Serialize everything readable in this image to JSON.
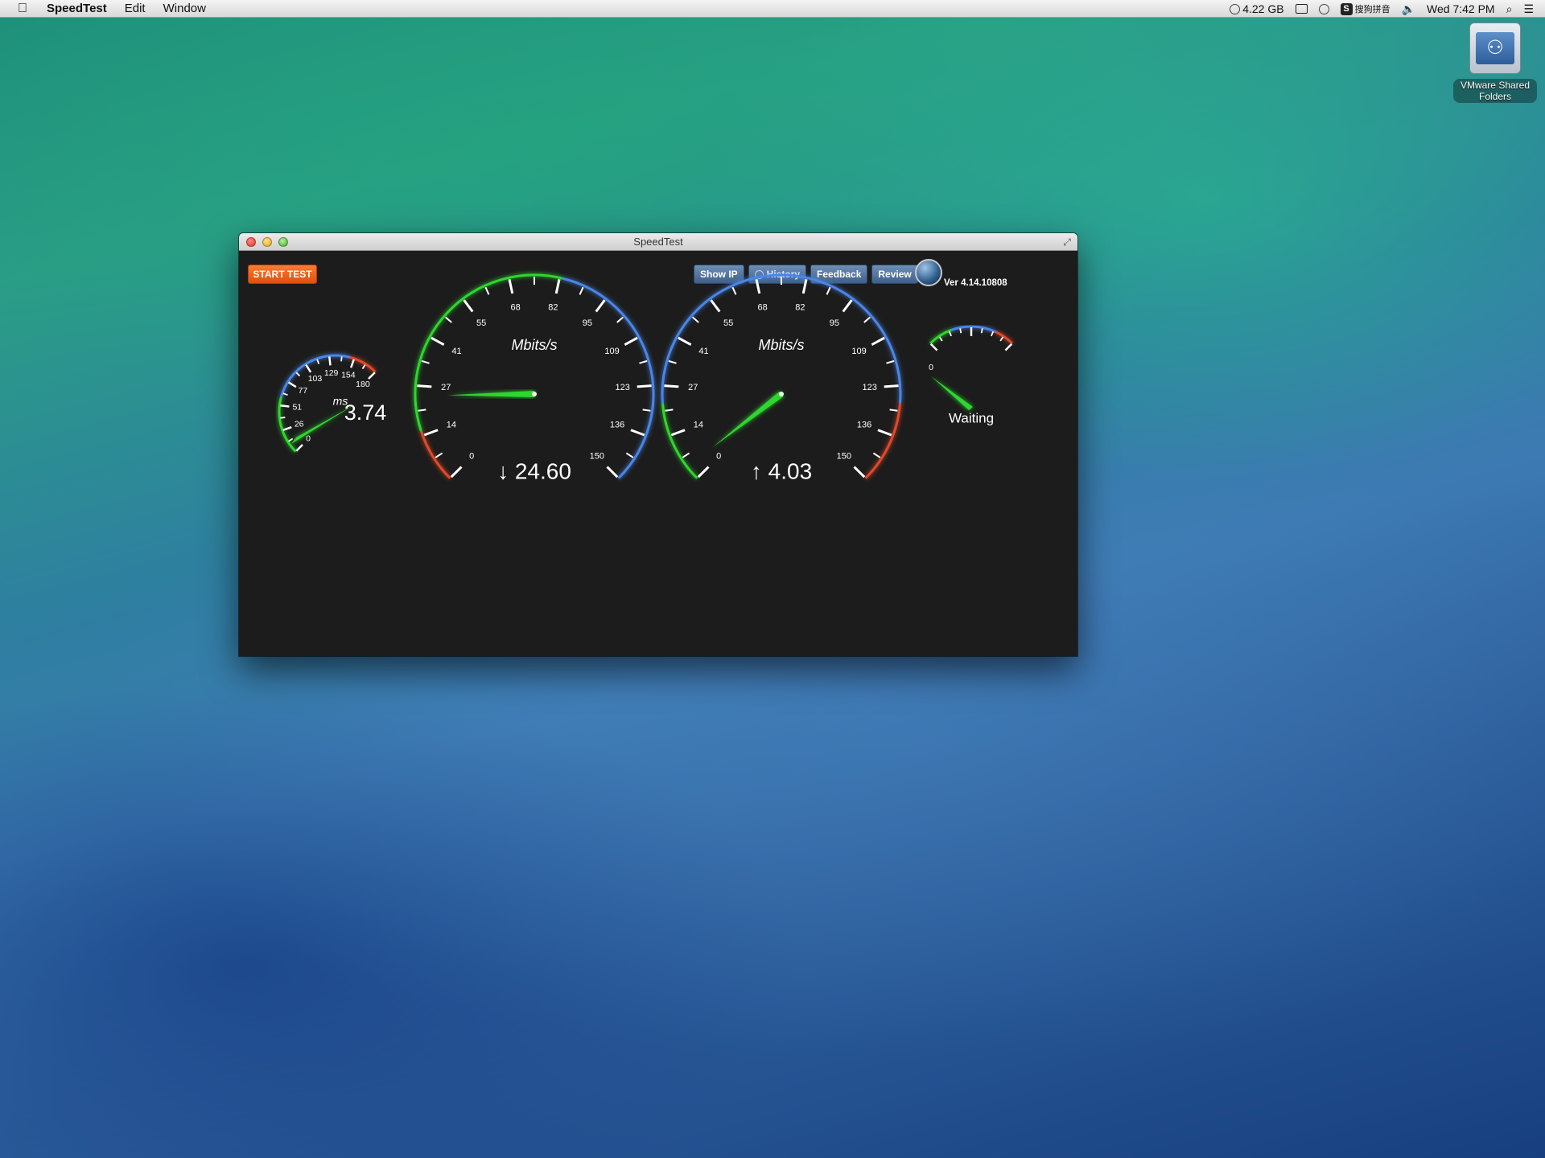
{
  "menubar": {
    "apple_icon": "apple-icon",
    "app_name": "SpeedTest",
    "menus": [
      "Edit",
      "Window"
    ],
    "memory": "4.22 GB",
    "input_method": "搜狗拼音",
    "clock": "Wed 7:42 PM"
  },
  "desktop": {
    "icon_label": "VMware Shared Folders"
  },
  "window": {
    "title": "SpeedTest",
    "start_button": "START TEST",
    "buttons": {
      "show_ip": "Show IP",
      "history": "History",
      "feedback": "Feedback",
      "review": "Review"
    },
    "version": "Ver 4.14.10808",
    "colors": {
      "green": "#2ed62e",
      "blue": "#4a86e8",
      "red": "#e0482a",
      "accent_orange": "#ee6118"
    },
    "ping_gauge": {
      "unit": "ms",
      "ticks": [
        "0",
        "26",
        "51",
        "77",
        "103",
        "129",
        "154",
        "180"
      ],
      "value": "3.74",
      "needle_value": 3.74,
      "max": 180
    },
    "download_gauge": {
      "unit": "Mbits/s",
      "ticks": [
        "0",
        "14",
        "27",
        "41",
        "55",
        "68",
        "82",
        "95",
        "109",
        "123",
        "136",
        "150"
      ],
      "arrow": "↓",
      "value": "24.60",
      "needle_value": 24.6,
      "max": 150
    },
    "upload_gauge": {
      "unit": "Mbits/s",
      "ticks": [
        "0",
        "14",
        "27",
        "41",
        "55",
        "68",
        "82",
        "95",
        "109",
        "123",
        "136",
        "150"
      ],
      "arrow": "↑",
      "value": "4.03",
      "needle_value": 4.03,
      "max": 150
    },
    "status_gauge": {
      "tick": "0",
      "status": "Waiting"
    }
  }
}
